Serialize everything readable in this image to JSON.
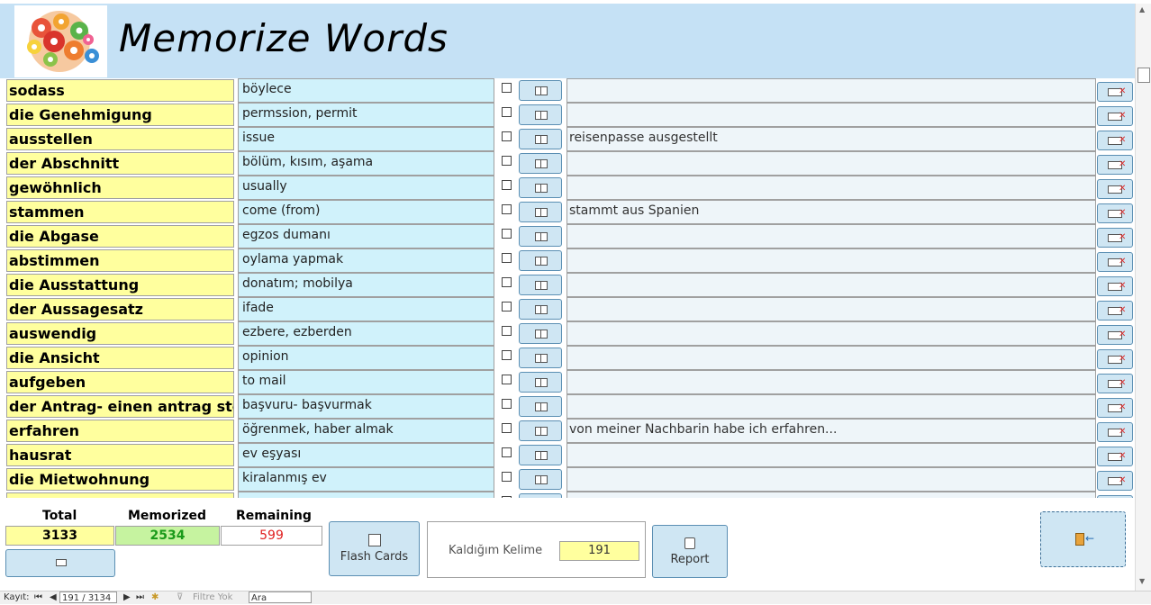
{
  "header": {
    "title": "Memorize Words"
  },
  "rows": [
    {
      "word": "sodass",
      "meaning": "böylece",
      "example": ""
    },
    {
      "word": "die Genehmigung",
      "meaning": "permssion, permit",
      "example": ""
    },
    {
      "word": "ausstellen",
      "meaning": "issue",
      "example": "reisenpasse ausgestellt"
    },
    {
      "word": "der Abschnitt",
      "meaning": "bölüm, kısım, aşama",
      "example": ""
    },
    {
      "word": "gewöhnlich",
      "meaning": "usually",
      "example": ""
    },
    {
      "word": "stammen",
      "meaning": "come (from)",
      "example": "stammt aus Spanien"
    },
    {
      "word": "die Abgase",
      "meaning": "egzos dumanı",
      "example": ""
    },
    {
      "word": "abstimmen",
      "meaning": "oylama yapmak",
      "example": ""
    },
    {
      "word": "die Ausstattung",
      "meaning": "donatım; mobilya",
      "example": ""
    },
    {
      "word": "der Aussagesatz",
      "meaning": "ifade",
      "example": ""
    },
    {
      "word": "auswendig",
      "meaning": "ezbere, ezberden",
      "example": ""
    },
    {
      "word": "die Ansicht",
      "meaning": "opinion",
      "example": ""
    },
    {
      "word": "aufgeben",
      "meaning": "to mail",
      "example": ""
    },
    {
      "word": "der Antrag- einen antrag stellen",
      "meaning": "başvuru- başvurmak",
      "example": ""
    },
    {
      "word": "erfahren",
      "meaning": "öğrenmek, haber almak",
      "example": "von meiner Nachbarin habe ich erfahren..."
    },
    {
      "word": "hausrat",
      "meaning": "ev eşyası",
      "example": ""
    },
    {
      "word": "die Mietwohnung",
      "meaning": "kiralanmış ev",
      "example": ""
    },
    {
      "word": "",
      "meaning": "",
      "example": ""
    }
  ],
  "stats": {
    "total_label": "Total",
    "total_value": "3133",
    "memorized_label": "Memorized",
    "memorized_value": "2534",
    "remaining_label": "Remaining",
    "remaining_value": "599"
  },
  "buttons": {
    "flash_cards": "Flash Cards",
    "report": "Report"
  },
  "panel": {
    "label": "Kaldığım Kelime",
    "value": "191"
  },
  "statusbar": {
    "record_label": "Kayıt:",
    "record_value": "191 / 3134",
    "filter_label": "Filtre Yok",
    "search_value": "Ara"
  },
  "colors": {
    "word_bg": "#ffff9e",
    "meaning_bg": "#d0f2fb",
    "memorized_bg": "#c6f3a0",
    "remaining_text": "#e02020",
    "memorized_text": "#1a9a1a"
  }
}
